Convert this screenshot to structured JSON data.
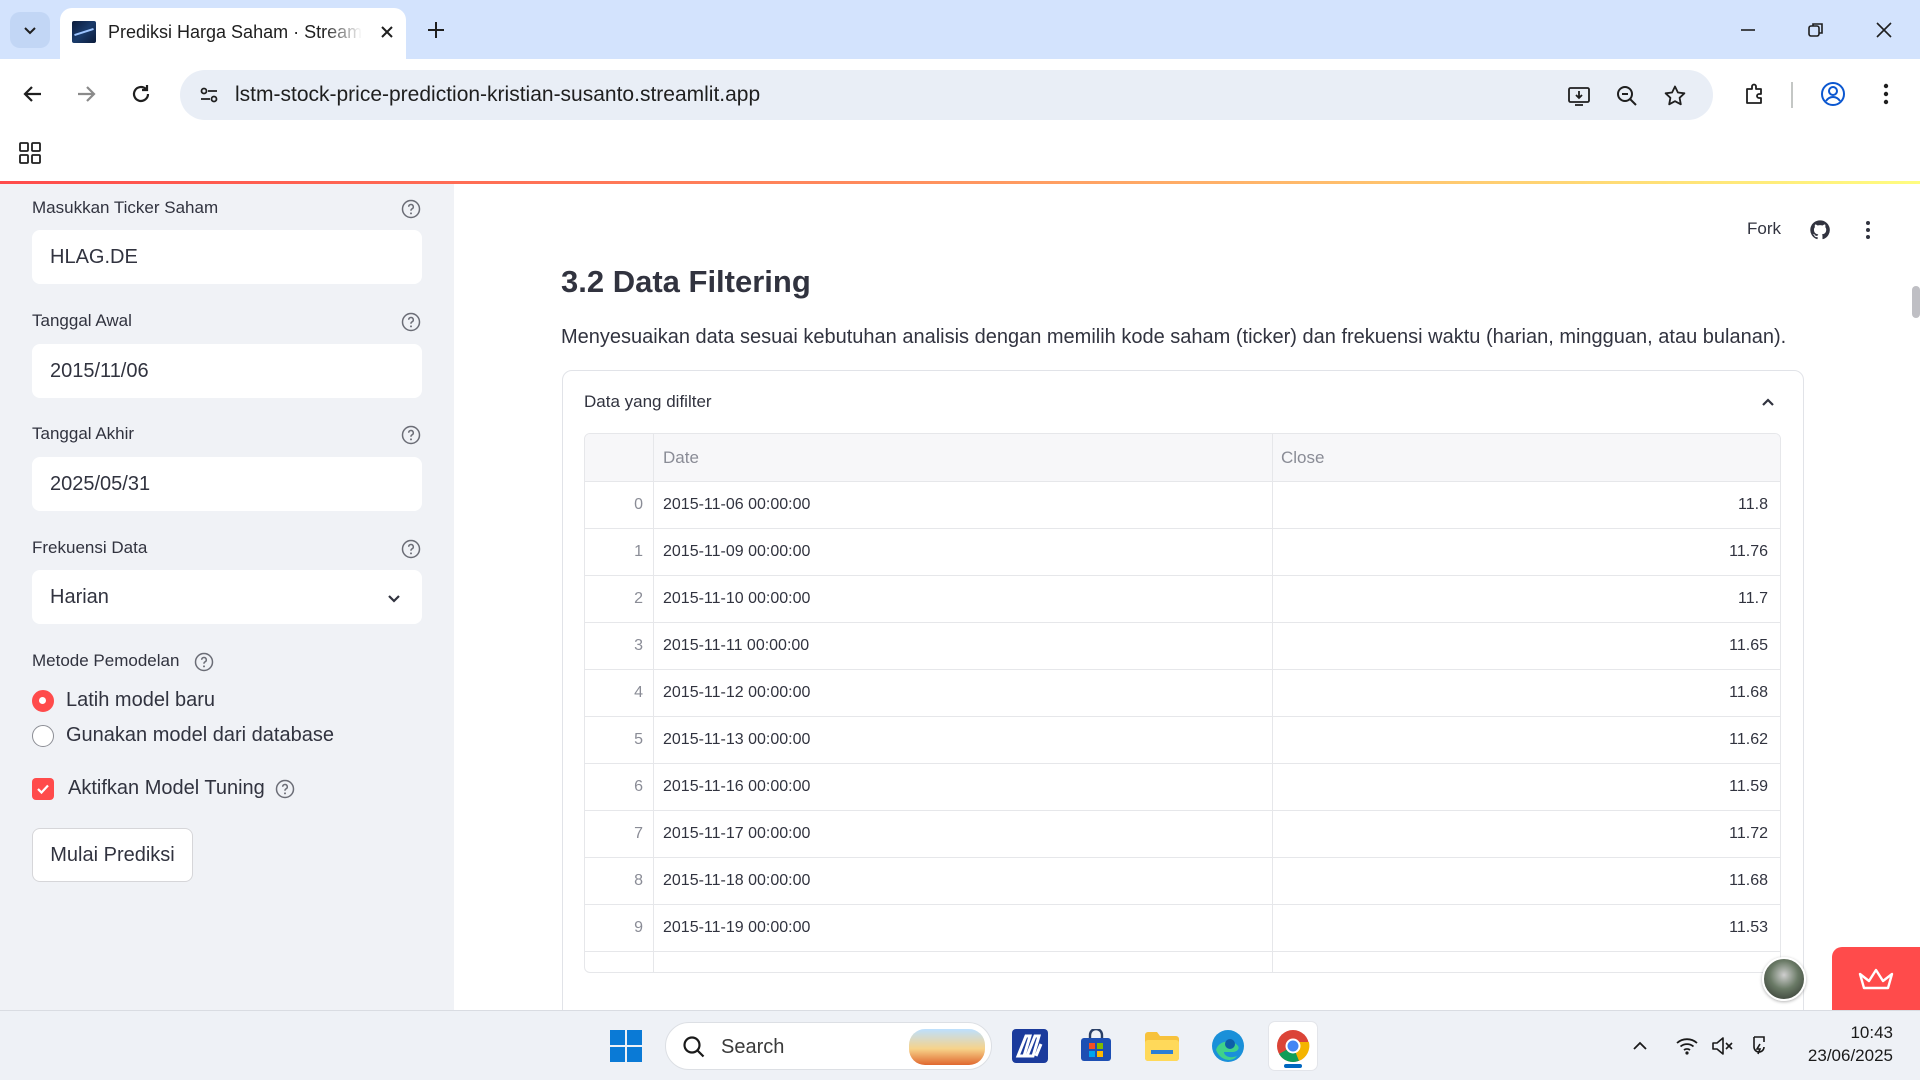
{
  "browser": {
    "tab_title": "Prediksi Harga Saham · Streamlit",
    "url": "lstm-stock-price-prediction-kristian-susanto.streamlit.app"
  },
  "header": {
    "fork_label": "Fork"
  },
  "sidebar": {
    "ticker": {
      "label": "Masukkan Ticker Saham",
      "value": "HLAG.DE"
    },
    "start_date": {
      "label": "Tanggal Awal",
      "value": "2015/11/06"
    },
    "end_date": {
      "label": "Tanggal Akhir",
      "value": "2025/05/31"
    },
    "frequency": {
      "label": "Frekuensi Data",
      "value": "Harian"
    },
    "method": {
      "label": "Metode Pemodelan",
      "options": [
        "Latih model baru",
        "Gunakan model dari database"
      ],
      "selected_index": 0
    },
    "tuning": {
      "label": "Aktifkan Model Tuning",
      "checked": true
    },
    "run_button": "Mulai Prediksi"
  },
  "main": {
    "section_title": "3.2 Data Filtering",
    "section_desc": "Menyesuaikan data sesuai kebutuhan analisis dengan memilih kode saham (ticker) dan frekuensi waktu (harian, mingguan, atau bulanan).",
    "expander_title": "Data yang difilter",
    "table": {
      "columns": [
        "",
        "Date",
        "Close"
      ],
      "rows": [
        {
          "index": "0",
          "date": "2015-11-06 00:00:00",
          "close": "11.8"
        },
        {
          "index": "1",
          "date": "2015-11-09 00:00:00",
          "close": "11.76"
        },
        {
          "index": "2",
          "date": "2015-11-10 00:00:00",
          "close": "11.7"
        },
        {
          "index": "3",
          "date": "2015-11-11 00:00:00",
          "close": "11.65"
        },
        {
          "index": "4",
          "date": "2015-11-12 00:00:00",
          "close": "11.68"
        },
        {
          "index": "5",
          "date": "2015-11-13 00:00:00",
          "close": "11.62"
        },
        {
          "index": "6",
          "date": "2015-11-16 00:00:00",
          "close": "11.59"
        },
        {
          "index": "7",
          "date": "2015-11-17 00:00:00",
          "close": "11.72"
        },
        {
          "index": "8",
          "date": "2015-11-18 00:00:00",
          "close": "11.68"
        },
        {
          "index": "9",
          "date": "2015-11-19 00:00:00",
          "close": "11.53"
        }
      ]
    }
  },
  "taskbar": {
    "search_label": "Search",
    "time": "10:43",
    "date": "23/06/2025"
  },
  "colors": {
    "accent": "#ff4b4b",
    "sidebar_bg": "#f0f2f6",
    "tabstrip_bg": "#d3e3fd",
    "omnibox_bg": "#e9eef6"
  }
}
